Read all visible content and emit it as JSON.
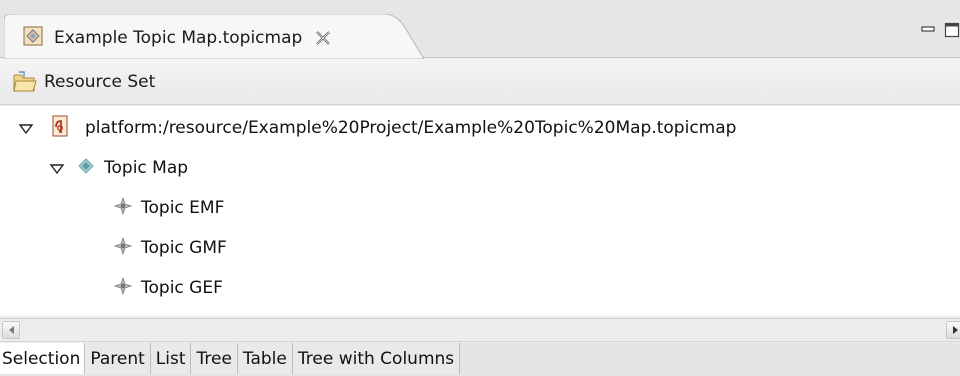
{
  "editor_tab": {
    "title": "Example Topic Map.topicmap"
  },
  "header": {
    "title": "Resource Set"
  },
  "tree": {
    "root": {
      "label": "platform:/resource/Example%20Project/Example%20Topic%20Map.topicmap",
      "expanded": true
    },
    "map": {
      "label": "Topic Map",
      "expanded": true
    },
    "topics": [
      {
        "label": "Topic EMF"
      },
      {
        "label": "Topic GMF"
      },
      {
        "label": "Topic GEF"
      }
    ]
  },
  "bottom_tabs": [
    {
      "label": "Selection",
      "active": true
    },
    {
      "label": "Parent",
      "active": false
    },
    {
      "label": "List",
      "active": false
    },
    {
      "label": "Tree",
      "active": false
    },
    {
      "label": "Table",
      "active": false
    },
    {
      "label": "Tree with Columns",
      "active": false
    }
  ],
  "colors": {
    "tree_background": "#ffffff",
    "topic_icon": "#8a8a8a",
    "map_icon": "#6fa7b0"
  }
}
